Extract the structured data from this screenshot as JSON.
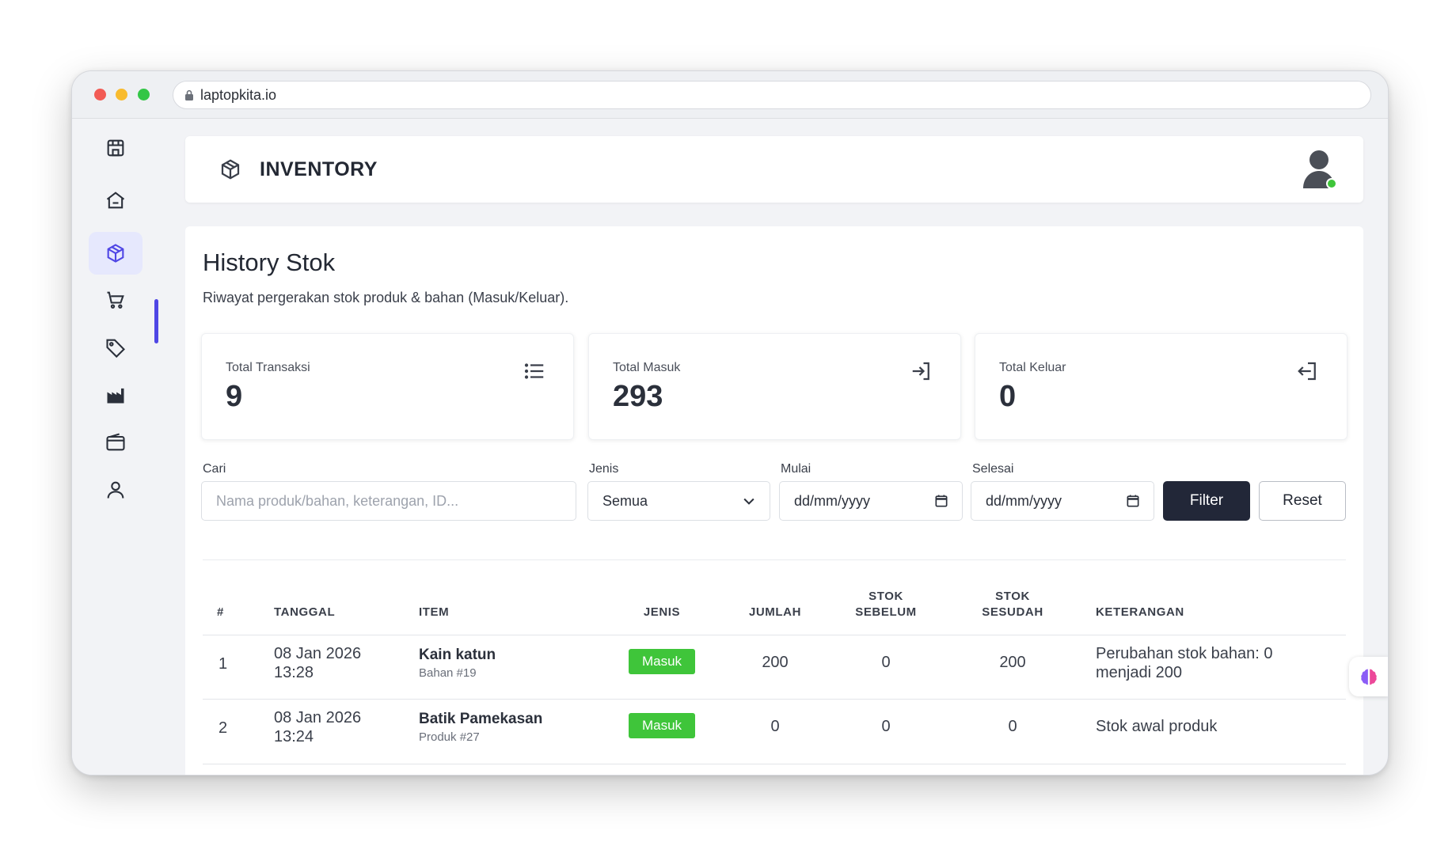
{
  "browser": {
    "url": "laptopkita.io"
  },
  "header": {
    "title": "INVENTORY"
  },
  "page": {
    "title": "History Stok",
    "subtitle": "Riwayat pergerakan stok produk & bahan (Masuk/Keluar)."
  },
  "stats": [
    {
      "label": "Total Transaksi",
      "value": "9",
      "icon": "list-icon"
    },
    {
      "label": "Total Masuk",
      "value": "293",
      "icon": "login-icon"
    },
    {
      "label": "Total Keluar",
      "value": "0",
      "icon": "logout-icon"
    }
  ],
  "filters": {
    "search_label": "Cari",
    "search_placeholder": "Nama produk/bahan, keterangan, ID...",
    "type_label": "Jenis",
    "type_value": "Semua",
    "start_label": "Mulai",
    "start_placeholder": "dd/mm/yyyy",
    "end_label": "Selesai",
    "end_placeholder": "dd/mm/yyyy",
    "filter_button": "Filter",
    "reset_button": "Reset"
  },
  "table": {
    "headers": {
      "no": "#",
      "date": "TANGGAL",
      "item": "ITEM",
      "type": "JENIS",
      "qty": "JUMLAH",
      "before_1": "STOK",
      "before_2": "SEBELUM",
      "after_1": "STOK",
      "after_2": "SESUDAH",
      "note": "KETERANGAN"
    },
    "rows": [
      {
        "no": "1",
        "date": "08 Jan 2026",
        "time": "13:28",
        "item": "Kain katun",
        "item_sub": "Bahan #19",
        "type": "Masuk",
        "qty": "200",
        "before": "0",
        "after": "200",
        "note_1": "Perubahan stok bahan: 0",
        "note_2": "menjadi 200"
      },
      {
        "no": "2",
        "date": "08 Jan 2026",
        "time": "13:24",
        "item": "Batik Pamekasan",
        "item_sub": "Produk #27",
        "type": "Masuk",
        "qty": "0",
        "before": "0",
        "after": "0",
        "note_1": "Stok awal produk",
        "note_2": ""
      }
    ]
  },
  "colors": {
    "accent": "#4f46e5",
    "success": "#3fc53a",
    "dark_button": "#222738"
  }
}
